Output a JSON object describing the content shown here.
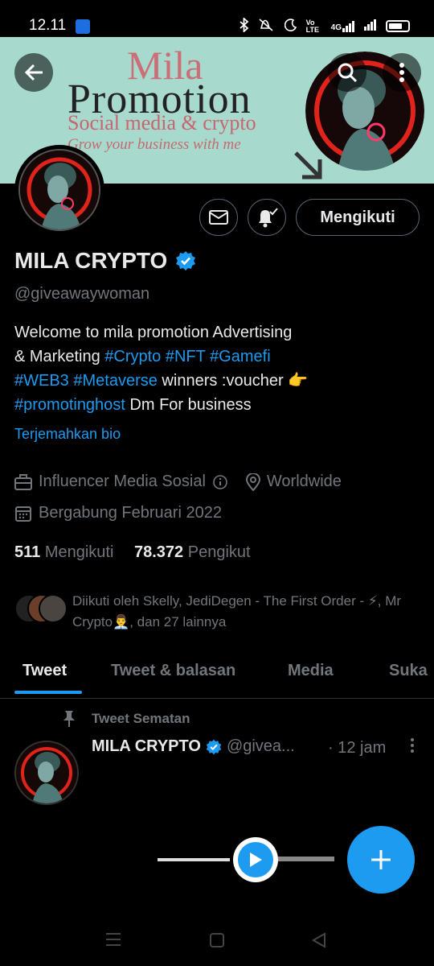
{
  "status_bar": {
    "time": "12.11",
    "icons": [
      "android-app-icon",
      "bluetooth-icon",
      "mute-icon",
      "moon-icon",
      "volte-icon",
      "signal-4g-icon",
      "signal-bars-icon",
      "battery-icon"
    ],
    "volte_text": "Vo LTE",
    "net_text": "4G"
  },
  "banner": {
    "title_line1": "Mila",
    "title_line2": "Promotion",
    "subtitle": "Social media & crypto",
    "tagline": "Grow your business with me",
    "background_color": "#a7d9cd"
  },
  "header_buttons": {
    "back": "back-arrow-icon",
    "search": "search-icon",
    "more": "more-vertical-icon"
  },
  "profile": {
    "name": "MILA CRYPTO",
    "verified": true,
    "handle": "@giveawaywoman",
    "bio": {
      "line1": "Welcome to mila promotion Advertising",
      "line2_pre": "& Marketing ",
      "tag1": "#Crypto",
      "tag2": "#NFT",
      "tag3": "#Gamefi",
      "tag4": "#WEB3",
      "tag5": "#Metaverse",
      "mid": "  winners :voucher 👉",
      "tag6": "#promotinghost",
      "end": " Dm For business"
    },
    "translate_label": "Terjemahkan bio",
    "category": "Influencer Media Sosial",
    "location": "Worldwide",
    "joined": "Bergabung Februari 2022",
    "following_count": "511",
    "following_label": "Mengikuti",
    "followers_count": "78.372",
    "followers_label": "Pengikut",
    "followed_by": "Diikuti oleh Skelly, JediDegen - The First Order - ⚡, Mr Crypto👨‍💼, dan 27 lainnya",
    "follow_button_label": "Mengikuti"
  },
  "tabs": [
    "Tweet",
    "Tweet & balasan",
    "Media",
    "Suka"
  ],
  "pinned_tweet": {
    "pinned_label": "Tweet Sematan",
    "author_name": "MILA CRYPTO",
    "author_handle": "@givea...",
    "time": "· 12 jam"
  },
  "colors": {
    "accent": "#1d9bf0",
    "background": "#000000",
    "muted_text": "#71767b",
    "primary_text": "#e7e9ea"
  }
}
